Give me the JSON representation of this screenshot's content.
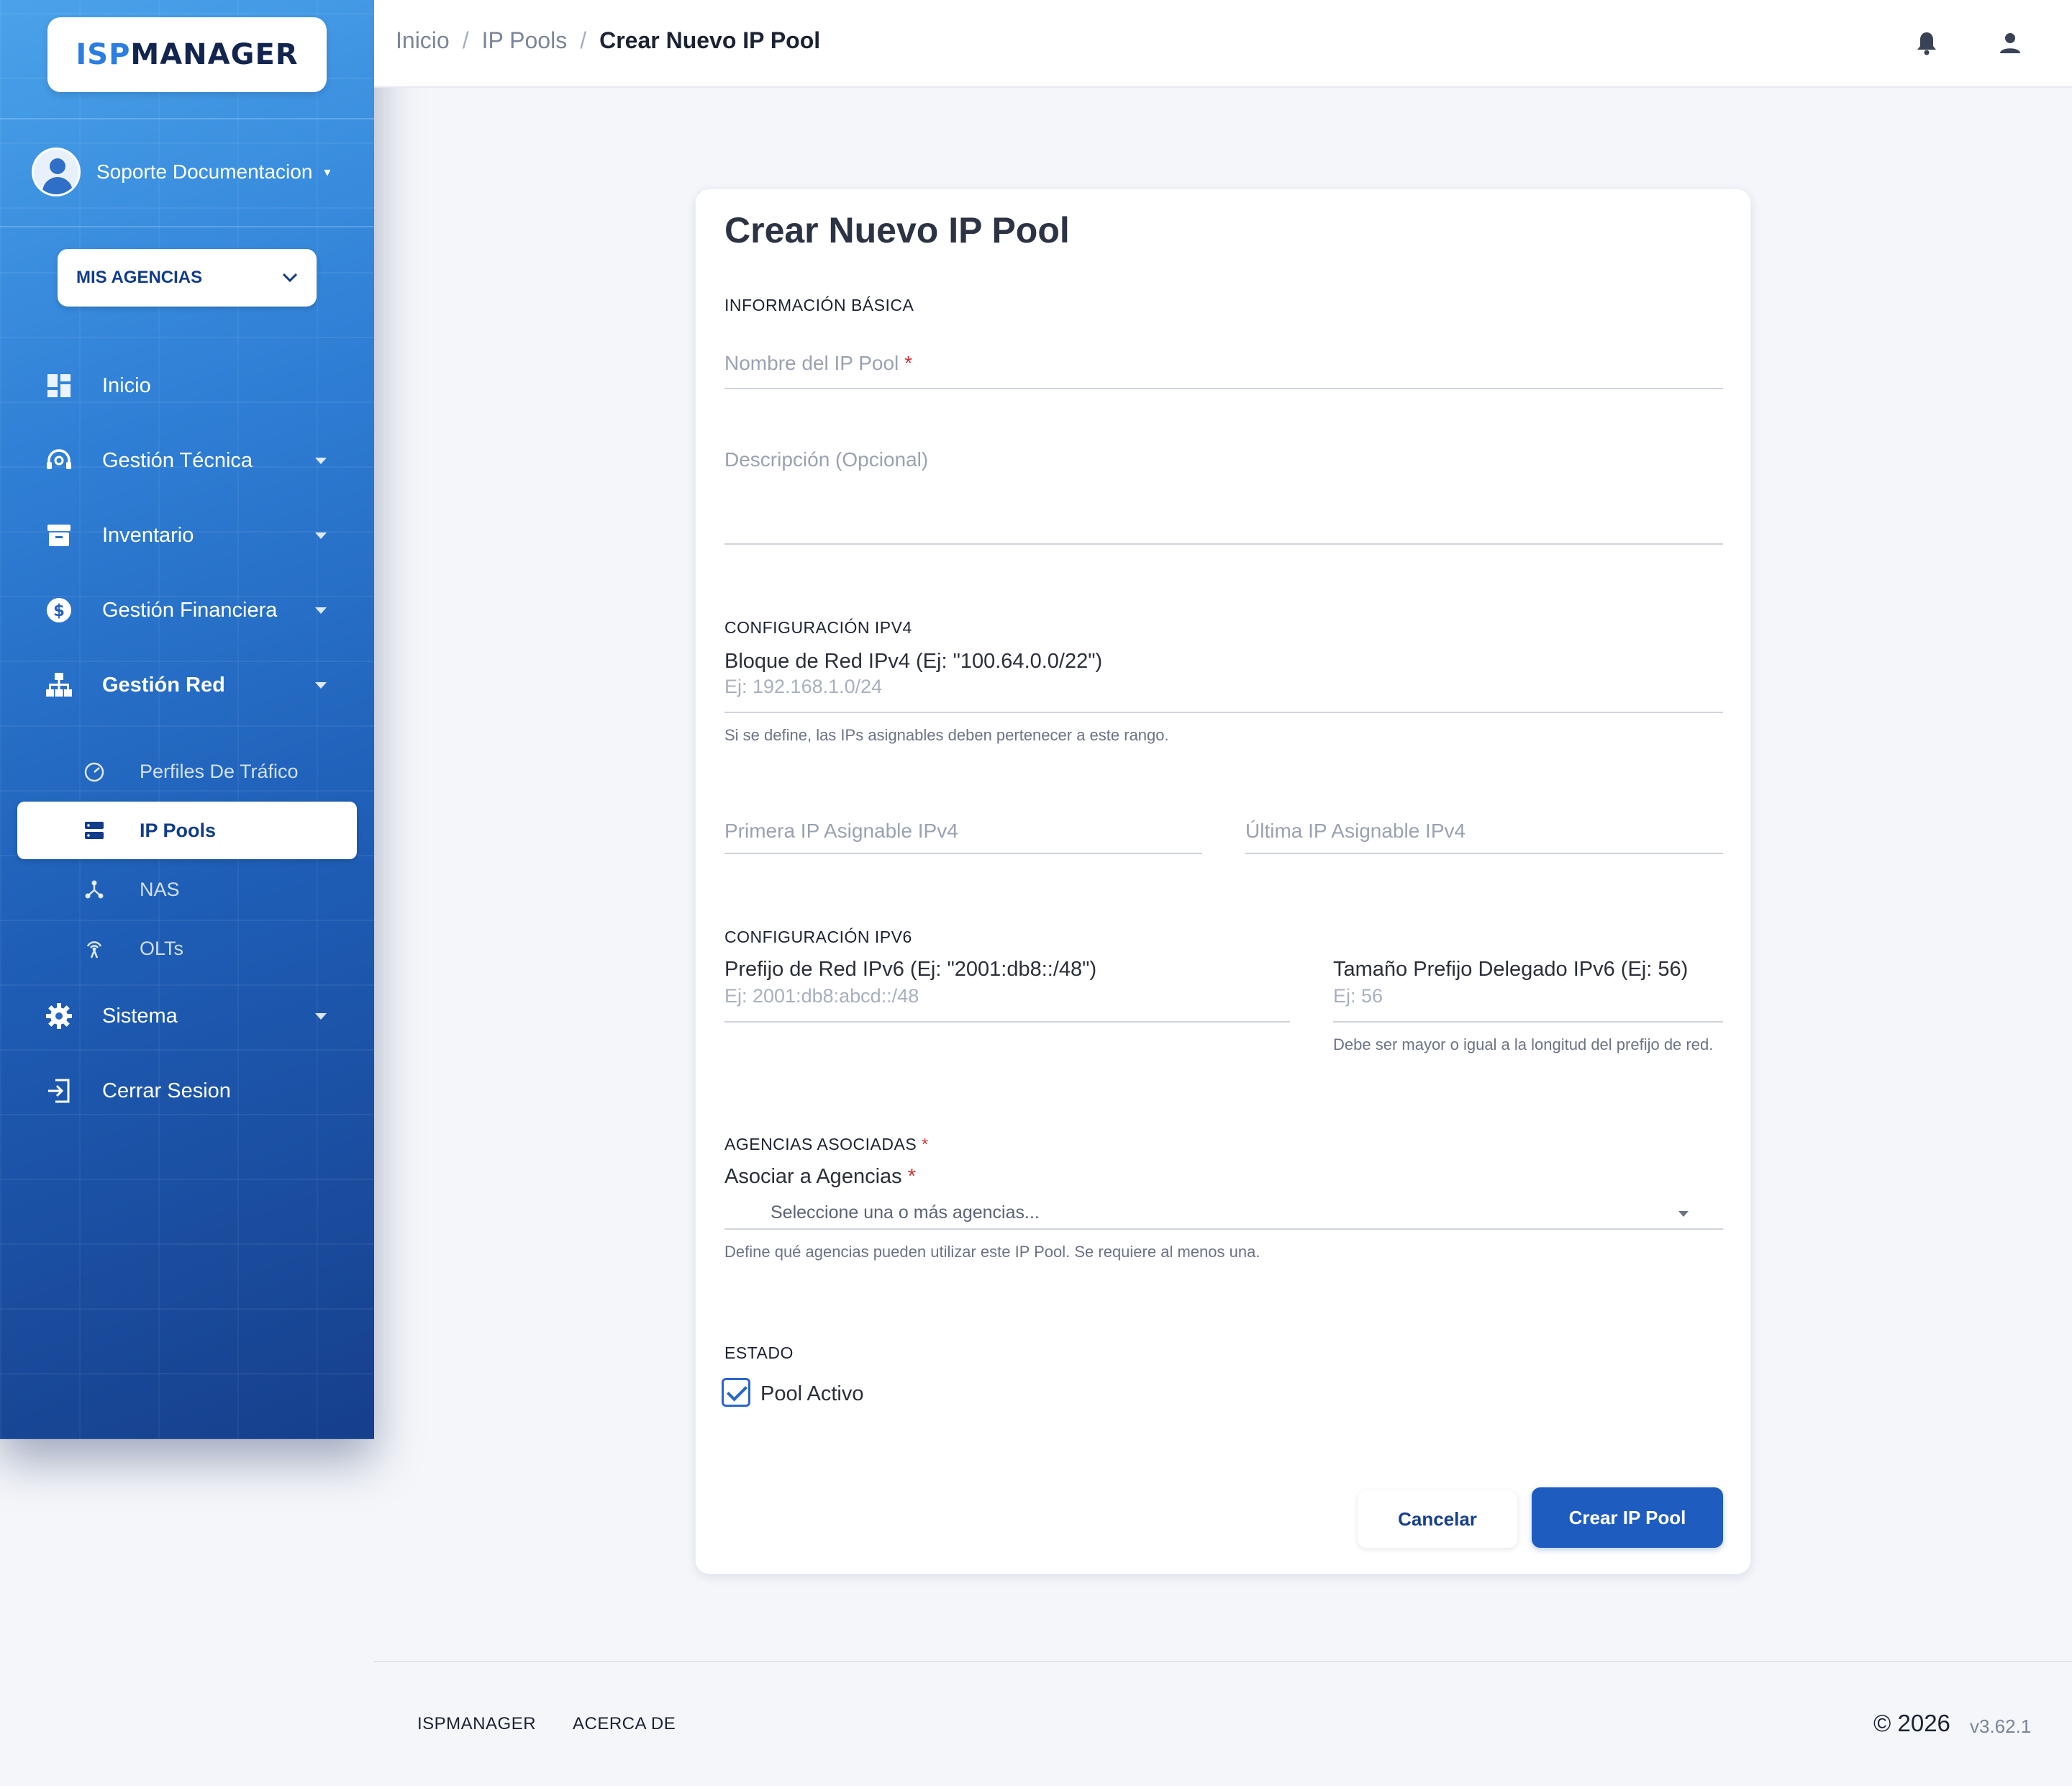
{
  "brand": {
    "logo_prefix": "ISP",
    "logo_suffix": "MANAGER"
  },
  "user": {
    "name": "Soporte Documentacion"
  },
  "agency_selector": {
    "label": "MIS AGENCIAS"
  },
  "sidebar": {
    "items": [
      {
        "label": "Inicio",
        "icon": "dashboard-icon"
      },
      {
        "label": "Gestión Técnica",
        "icon": "support-agent-icon"
      },
      {
        "label": "Inventario",
        "icon": "archive-icon"
      },
      {
        "label": "Gestión Financiera",
        "icon": "dollar-icon"
      },
      {
        "label": "Gestión Red",
        "icon": "network-icon"
      },
      {
        "label": "Sistema",
        "icon": "gear-icon"
      },
      {
        "label": "Cerrar Sesion",
        "icon": "logout-icon"
      }
    ],
    "subitems": [
      {
        "label": "Perfiles De Tráfico",
        "icon": "speedometer-icon"
      },
      {
        "label": "IP Pools",
        "icon": "storage-icon"
      },
      {
        "label": "NAS",
        "icon": "hub-icon"
      },
      {
        "label": "OLTs",
        "icon": "antenna-icon"
      }
    ]
  },
  "breadcrumb": {
    "items": [
      "Inicio",
      "IP Pools"
    ],
    "current": "Crear Nuevo IP Pool",
    "separator": "/"
  },
  "form": {
    "title": "Crear Nuevo IP Pool",
    "basic_section": "INFORMACIÓN BÁSICA",
    "pool_name_placeholder": "Nombre del IP Pool",
    "required_mark": "*",
    "description_placeholder": "Descripción (Opcional)",
    "ipv4_section": "CONFIGURACIÓN IPV4",
    "ipv4_block_label": "Bloque de Red IPv4 (Ej: \"100.64.0.0/22\")",
    "ipv4_block_placeholder": "Ej: 192.168.1.0/24",
    "ipv4_block_helper": "Si se define, las IPs asignables deben pertenecer a este rango.",
    "first_ip_placeholder": "Primera IP Asignable IPv4",
    "last_ip_placeholder": "Última IP Asignable IPv4",
    "ipv6_section": "CONFIGURACIÓN IPV6",
    "ipv6_prefix_label": "Prefijo de Red IPv6 (Ej: \"2001:db8::/48\")",
    "ipv6_prefix_placeholder": "Ej: 2001:db8:abcd::/48",
    "ipv6_delegated_label": "Tamaño Prefijo Delegado IPv6 (Ej: 56)",
    "ipv6_delegated_placeholder": "Ej: 56",
    "ipv6_delegated_helper": "Debe ser mayor o igual a la longitud del prefijo de red.",
    "agencies_section": "AGENCIAS ASOCIADAS",
    "agencies_label": "Asociar a Agencias",
    "agencies_placeholder": "Seleccione una o más agencias...",
    "agencies_helper": "Define qué agencias pueden utilizar este IP Pool. Se requiere al menos una.",
    "status_section": "ESTADO",
    "active_label": "Pool Activo",
    "active_checked": true,
    "cancel_label": "Cancelar",
    "submit_label": "Crear IP Pool"
  },
  "footer": {
    "link1": "ISPMANAGER",
    "link2": "ACERCA DE",
    "copyright": "© 2026",
    "version": "v3.62.1"
  },
  "colors": {
    "primary": "#1f5cc0",
    "sidebar_top": "#4aa3ea",
    "sidebar_bottom": "#163f8c",
    "required": "#d0302f"
  }
}
